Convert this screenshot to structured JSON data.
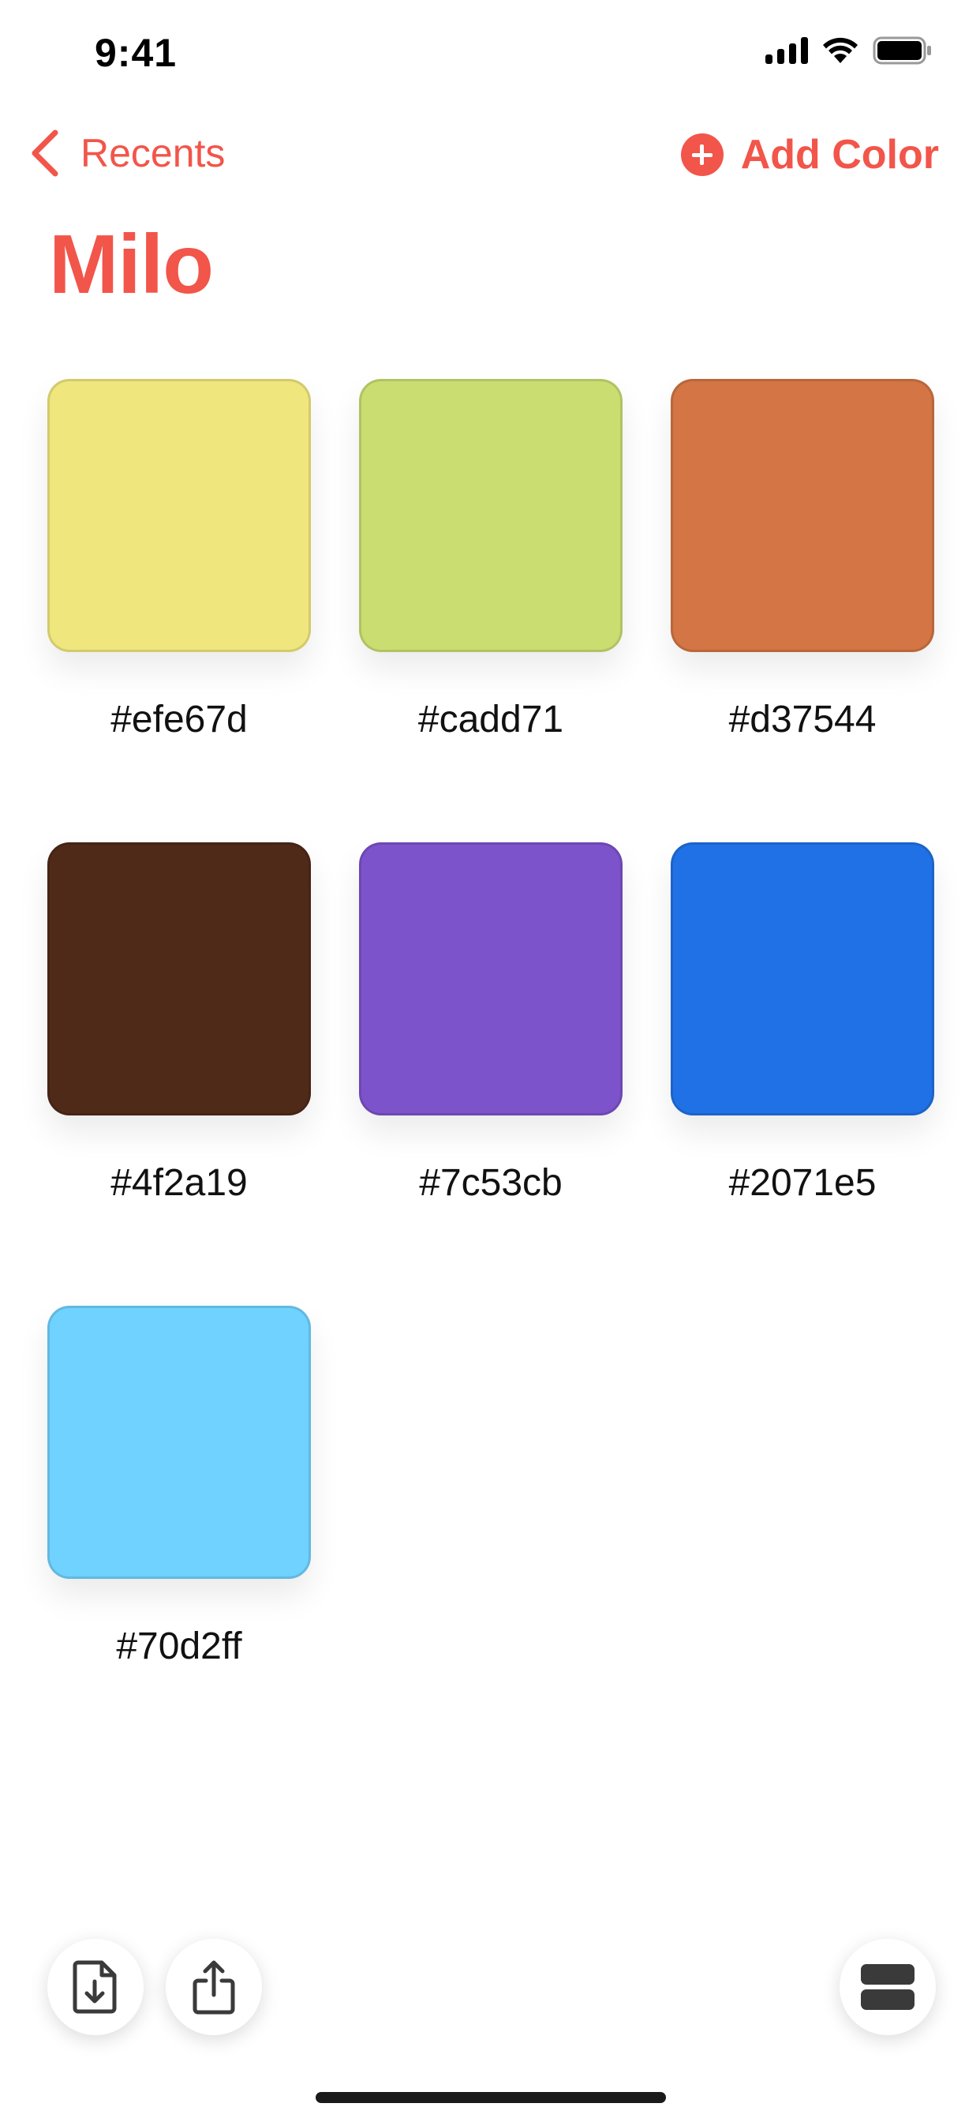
{
  "status_bar": {
    "time": "9:41"
  },
  "nav": {
    "back_label": "Recents",
    "add_label": "Add Color"
  },
  "page": {
    "title": "Milo"
  },
  "colors": {
    "accent": "#f2554a",
    "icon_dark": "#3a3a3a"
  },
  "swatches": [
    {
      "hex": "#efe67d",
      "label": "#efe67d"
    },
    {
      "hex": "#cadd71",
      "label": "#cadd71"
    },
    {
      "hex": "#d37544",
      "label": "#d37544"
    },
    {
      "hex": "#4f2a19",
      "label": "#4f2a19"
    },
    {
      "hex": "#7c53cb",
      "label": "#7c53cb"
    },
    {
      "hex": "#2071e5",
      "label": "#2071e5"
    },
    {
      "hex": "#70d2ff",
      "label": "#70d2ff"
    }
  ],
  "toolbar": {
    "import_icon": "document-download-icon",
    "share_icon": "share-icon",
    "layout_icon": "stacked-rows-icon"
  }
}
